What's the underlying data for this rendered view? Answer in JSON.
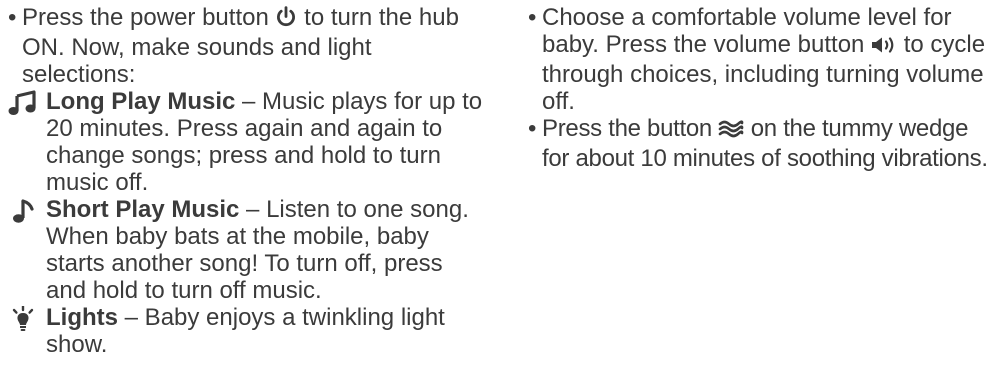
{
  "left": {
    "intro": {
      "before_icon": "Press the power button",
      "after_icon": " to turn the hub ON. Now, make sounds and light selections:",
      "icon": "power-icon"
    },
    "features": [
      {
        "icon": "music-notes-icon",
        "title": "Long Play Music",
        "text": " – Music plays for up to 20 minutes. Press again and again to change songs; press and hold to turn music off."
      },
      {
        "icon": "music-note-icon",
        "title": "Short Play Music",
        "text": " – Listen to one song. When baby bats at the mobile, baby starts another song! To turn off, press and hold to turn off music."
      },
      {
        "icon": "light-bulb-icon",
        "title": "Lights",
        "text": " – Baby enjoys a twinkling light show."
      }
    ]
  },
  "right": {
    "volume": {
      "before_icon": "Choose a comfortable volume level for baby. Press the volume button",
      "after_icon": " to cycle through choices, including turning volume off.",
      "icon": "volume-icon"
    },
    "vibration": {
      "before_icon": "Press the button",
      "after_icon": " on the tummy wedge for about 10 minutes of soothing vibrations.",
      "icon": "vibration-icon"
    }
  },
  "bullet_char": "•"
}
